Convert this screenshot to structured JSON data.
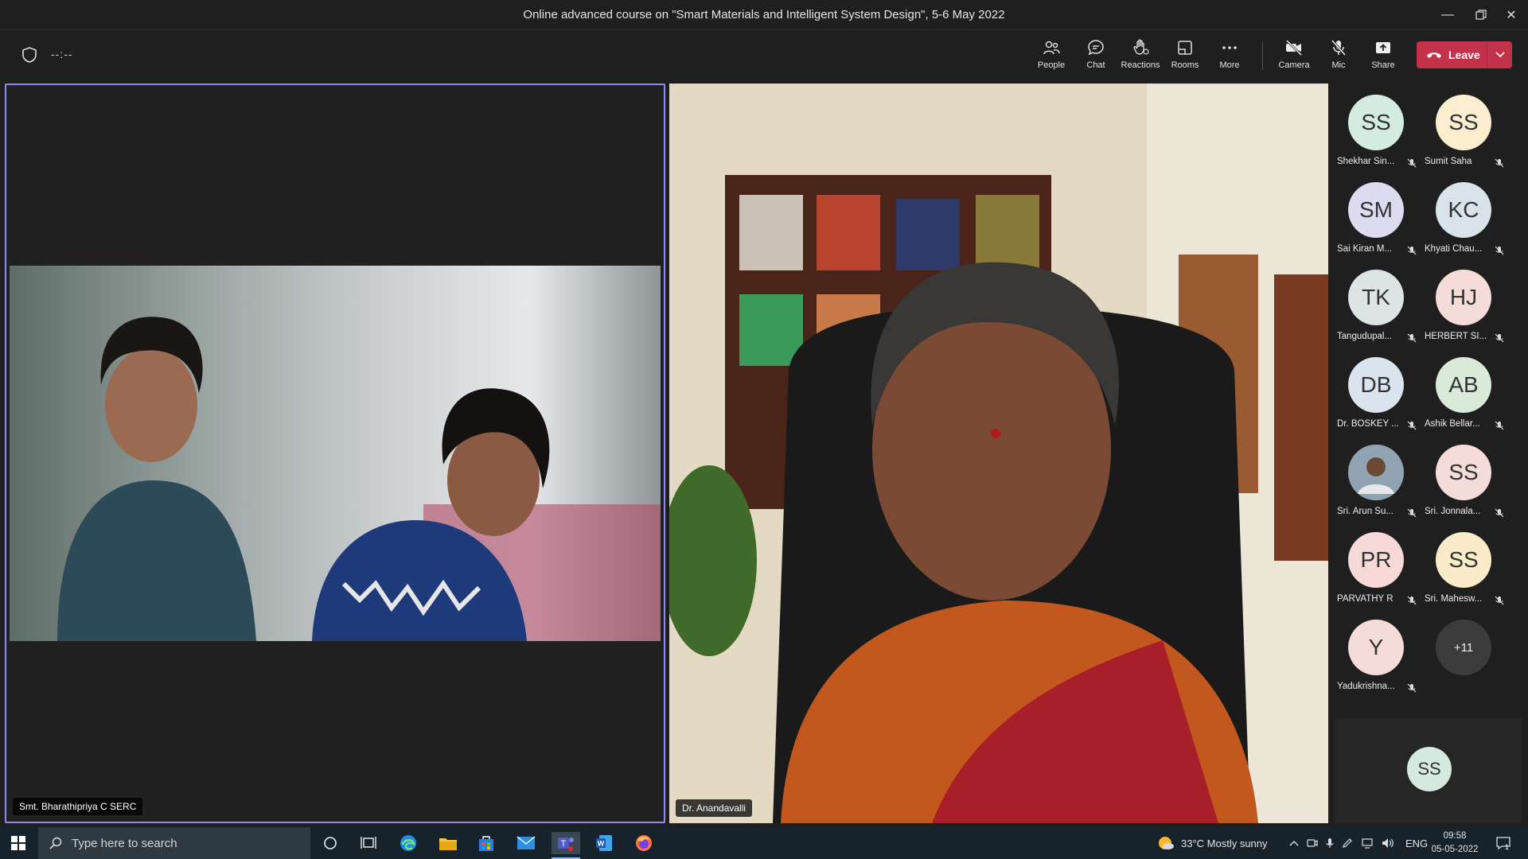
{
  "window": {
    "title": "Online advanced course on \"Smart Materials and Intelligent System Design\", 5-6 May 2022"
  },
  "toolbar": {
    "timer": "--:--",
    "buttons": {
      "people": "People",
      "chat": "Chat",
      "reactions": "Reactions",
      "rooms": "Rooms",
      "more": "More",
      "camera": "Camera",
      "mic": "Mic",
      "share": "Share"
    },
    "leave_label": "Leave"
  },
  "tiles": {
    "left_name": "Smt. Bharathipriya C SERC",
    "right_name": "Dr. Anandavalli"
  },
  "participants": [
    {
      "initials": "SS",
      "name": "Shekhar Sin...",
      "color": "#d3ecdf"
    },
    {
      "initials": "SS",
      "name": "Sumit Saha",
      "color": "#fbeecf"
    },
    {
      "initials": "SM",
      "name": "Sai Kiran M...",
      "color": "#dddbf0"
    },
    {
      "initials": "KC",
      "name": "Khyati Chau...",
      "color": "#d9e4ea"
    },
    {
      "initials": "TK",
      "name": "Tangudupal...",
      "color": "#dde4e6"
    },
    {
      "initials": "HJ",
      "name": "HERBERT SI...",
      "color": "#f5dcd9"
    },
    {
      "initials": "DB",
      "name": "Dr. BOSKEY ...",
      "color": "#d9e4ee"
    },
    {
      "initials": "AB",
      "name": "Ashik Bellar...",
      "color": "#d9ead9"
    },
    {
      "initials": "",
      "name": "Sri. Arun Su...",
      "color": "#7a8a9a"
    },
    {
      "initials": "SS",
      "name": "Sri. Jonnala...",
      "color": "#f5dcd9"
    },
    {
      "initials": "PR",
      "name": "PARVATHY R",
      "color": "#f7dad8"
    },
    {
      "initials": "SS",
      "name": "Sri. Mahesw...",
      "color": "#faecc9"
    },
    {
      "initials": "Y",
      "name": "Yadukrishna...",
      "color": "#f5dcd9"
    }
  ],
  "overflow_count": "+11",
  "self_initials": "SS",
  "taskbar": {
    "search_placeholder": "Type here to search",
    "weather": "33°C  Mostly sunny",
    "lang": "ENG",
    "time": "09:58",
    "date": "05-05-2022",
    "notification_count": "1"
  }
}
